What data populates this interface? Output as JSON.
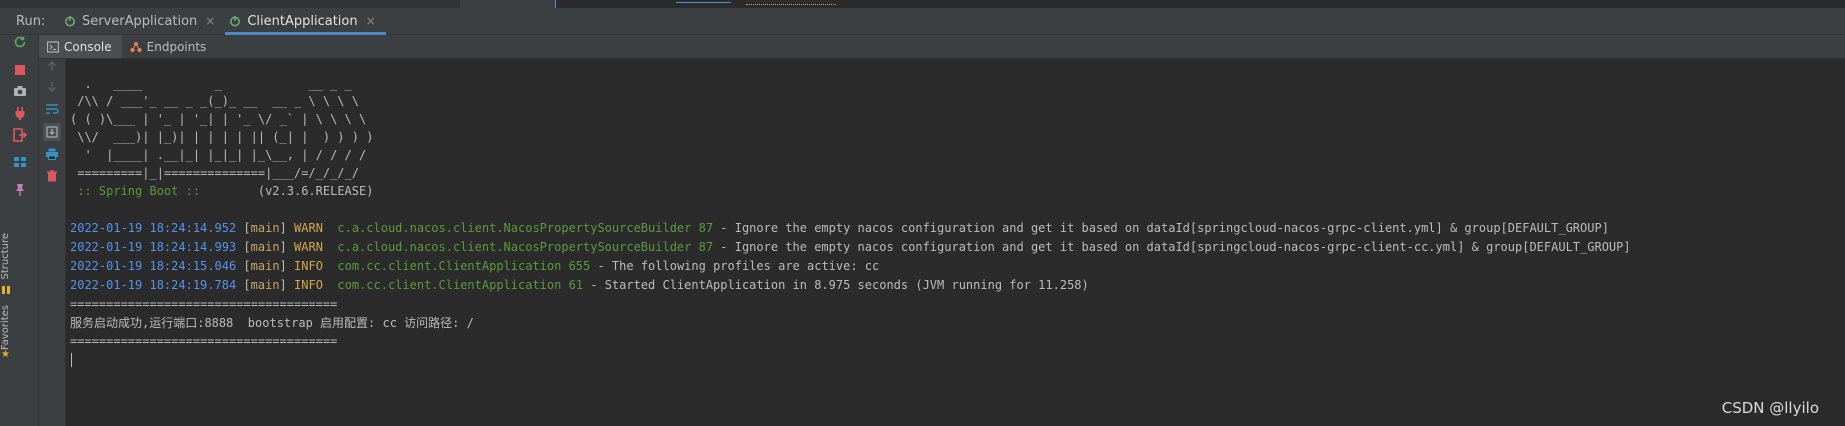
{
  "run_bar": {
    "label": "Run:",
    "tabs": [
      {
        "label": "ServerApplication",
        "close": "×"
      },
      {
        "label": "ClientApplication",
        "close": "×"
      }
    ]
  },
  "sub_tabs": [
    {
      "label": "Console"
    },
    {
      "label": "Endpoints"
    }
  ],
  "side_labels": {
    "structure": "Structure",
    "favorites": "Favorites"
  },
  "console": {
    "banner": [
      "  .   ____          _            __ _ _",
      " /\\\\ / ___'_ __ _ _(_)_ __  __ _ \\ \\ \\ \\",
      "( ( )\\___ | '_ | '_| | '_ \\/ _` | \\ \\ \\ \\",
      " \\\\/  ___)| |_)| | | | | || (_| |  ) ) ) )",
      "  '  |____| .__|_| |_|_| |_\\__, | / / / /",
      " =========|_|==============|___/=/_/_/_/"
    ],
    "spring_label": " :: Spring Boot ::",
    "spring_version": "        (v2.3.6.RELEASE)",
    "logs": [
      {
        "date": "2022-01-19 18:24:14.952",
        "thread": "main",
        "level": "WARN ",
        "logger": "c.a.cloud.nacos.client.NacosPropertySourceBuilder 87",
        "message": " - Ignore the empty nacos configuration and get it based on dataId[springcloud-nacos-grpc-client.yml] & group[DEFAULT_GROUP]"
      },
      {
        "date": "2022-01-19 18:24:14.993",
        "thread": "main",
        "level": "WARN ",
        "logger": "c.a.cloud.nacos.client.NacosPropertySourceBuilder 87",
        "message": " - Ignore the empty nacos configuration and get it based on dataId[springcloud-nacos-grpc-client-cc.yml] & group[DEFAULT_GROUP]"
      },
      {
        "date": "2022-01-19 18:24:15.046",
        "thread": "main",
        "level": "INFO ",
        "logger": "com.cc.client.ClientApplication 655",
        "message": " - The following profiles are active: cc"
      },
      {
        "date": "2022-01-19 18:24:19.784",
        "thread": "main",
        "level": "INFO ",
        "logger": "com.cc.client.ClientApplication 61",
        "message": " - Started ClientApplication in 8.975 seconds (JVM running for 11.258)"
      }
    ],
    "separator_1": "=====================================",
    "status_line": "服务启动成功,运行端口:8888  bootstrap 启用配置: cc 访问路径: /",
    "separator_2": "====================================="
  },
  "watermark": "CSDN @llyilo",
  "colors": {
    "background": "#2b2b2b",
    "panel": "#3c3f41",
    "accent_tab": "#4a88c7",
    "date": "#5394ec",
    "logger": "#5a9a3c",
    "level": "#d5a54f"
  }
}
